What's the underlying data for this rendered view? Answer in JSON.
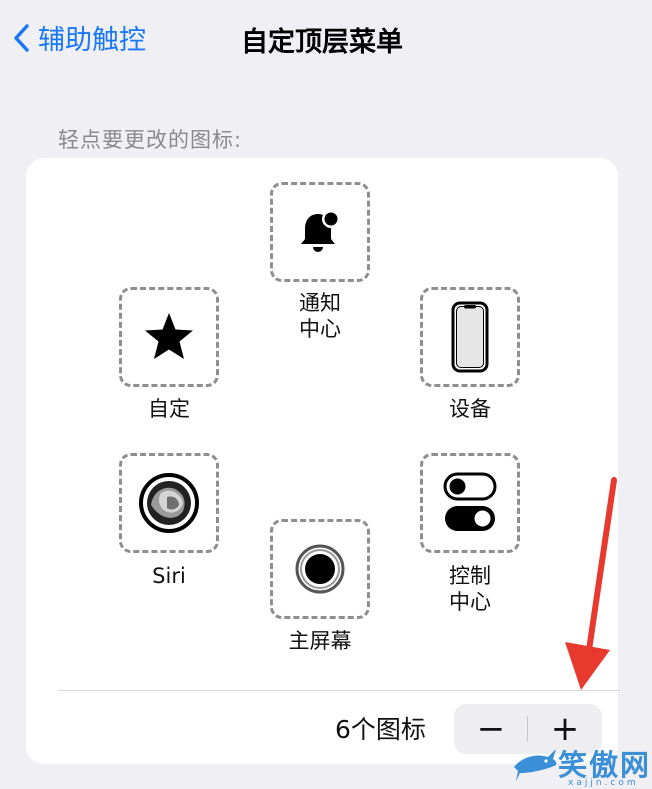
{
  "nav": {
    "back_label": "辅助触控",
    "title": "自定顶层菜单"
  },
  "hint": "轻点要更改的图标:",
  "icons": {
    "notification": {
      "label": "通知\n中心",
      "icon": "bell-badge-icon"
    },
    "custom": {
      "label": "自定",
      "icon": "star-icon"
    },
    "device": {
      "label": "设备",
      "icon": "iphone-icon"
    },
    "siri": {
      "label": "Siri",
      "icon": "siri-icon"
    },
    "home": {
      "label": "主屏幕",
      "icon": "home-button-icon"
    },
    "control_center": {
      "label": "控制\n中心",
      "icon": "toggles-icon"
    }
  },
  "footer": {
    "count_label": "6个图标",
    "minus": "−",
    "plus": "+"
  },
  "watermark": {
    "text": "笑傲网",
    "sub": "xajjn.com"
  },
  "colors": {
    "accent": "#1a78f6",
    "arrow": "#e8392e",
    "background": "#efeff4"
  }
}
